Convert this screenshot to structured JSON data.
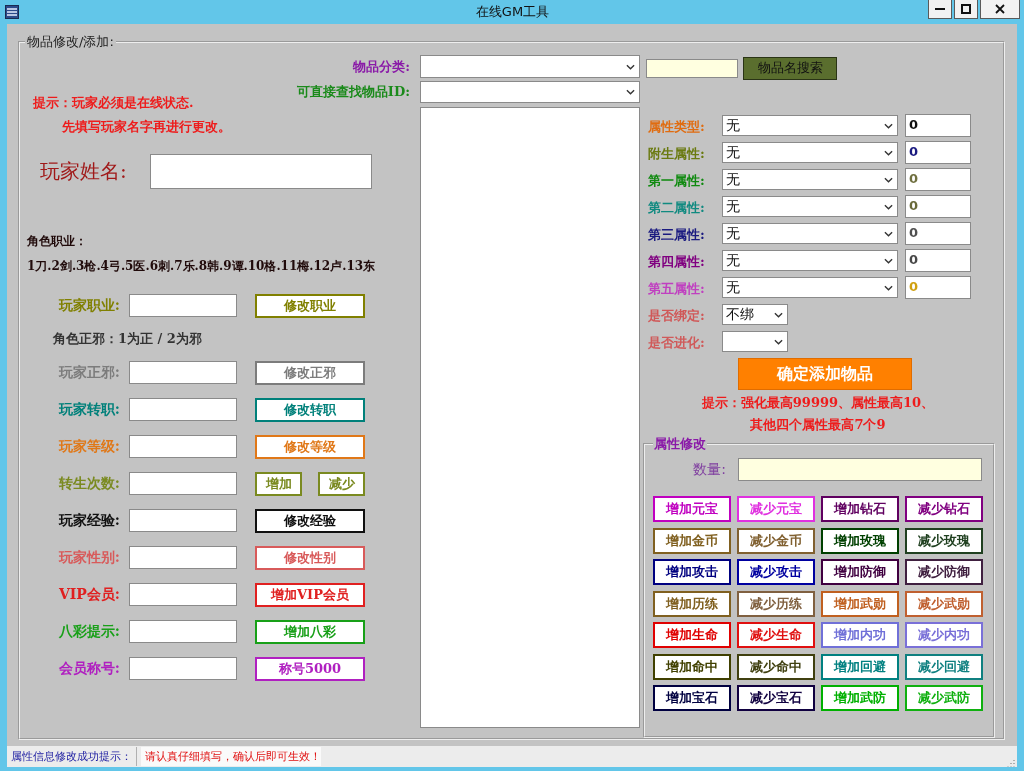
{
  "window": {
    "title": "在线GM工具"
  },
  "group": {
    "title": "物品修改/添加:"
  },
  "item_search": {
    "category_label": "物品分类:",
    "id_label": "可直接查找物品ID:",
    "search_button": "物品名搜索"
  },
  "notice": [
    "提示：玩家必须是在线状态.",
    "先填写玩家名字再进行更改。"
  ],
  "player_name": {
    "label": "玩家姓名:"
  },
  "jobs": {
    "title": "角色职业：",
    "legend": "1刀.2剑.3枪.4弓.5医.6刺.7乐.8韩.9谭.10格.11梅.12卢.13东"
  },
  "player_rows": [
    {
      "kind": "field",
      "label": "玩家职业:",
      "color": "#808000",
      "buttons": [
        "修改职业"
      ]
    },
    {
      "kind": "note",
      "text": "角色正邪：1为正 / 2为邪"
    },
    {
      "kind": "field",
      "label": "玩家正邪:",
      "color": "#7c7c7c",
      "buttons": [
        "修改正邪"
      ]
    },
    {
      "kind": "field",
      "label": "玩家转职:",
      "color": "#00807a",
      "buttons": [
        "修改转职"
      ]
    },
    {
      "kind": "field",
      "label": "玩家等级:",
      "color": "#e07818",
      "buttons": [
        "修改等级"
      ]
    },
    {
      "kind": "field",
      "label": "转生次数:",
      "color": "#7a8a20",
      "buttons": [
        "增加",
        "减少"
      ]
    },
    {
      "kind": "field",
      "label": "玩家经验:",
      "color": "#101010",
      "buttons": [
        "修改经验"
      ]
    },
    {
      "kind": "field",
      "label": "玩家性别:",
      "color": "#d85a5a",
      "buttons": [
        "修改性别"
      ]
    },
    {
      "kind": "field",
      "label": "VIP会员:",
      "color": "#e02020",
      "buttons": [
        "增加VIP会员"
      ]
    },
    {
      "kind": "field",
      "label": "八彩提示:",
      "color": "#18a018",
      "buttons": [
        "增加八彩"
      ]
    },
    {
      "kind": "field",
      "label": "会员称号:",
      "color": "#b020c0",
      "buttons": [
        "称号5000"
      ]
    }
  ],
  "attributes": [
    {
      "label": "属性类型:",
      "color": "#e06c10",
      "value": "无",
      "amount": {
        "text": "0",
        "color": "#101010"
      }
    },
    {
      "label": "附生属性:",
      "color": "#6a7a10",
      "value": "无",
      "amount": {
        "text": "0",
        "color": "#1a1a80"
      }
    },
    {
      "label": "第一属性:",
      "color": "#108a10",
      "value": "无",
      "amount": {
        "text": "0",
        "color": "#707040"
      }
    },
    {
      "label": "第二属性:",
      "color": "#108a80",
      "value": "无",
      "amount": {
        "text": "0",
        "color": "#6a6a3a"
      }
    },
    {
      "label": "第三属性:",
      "color": "#1a1a80",
      "value": "无",
      "amount": {
        "text": "0",
        "color": "#505050"
      }
    },
    {
      "label": "第四属性:",
      "color": "#800080",
      "value": "无",
      "amount": {
        "text": "0",
        "color": "#484848"
      }
    },
    {
      "label": "第五属性:",
      "color": "#c040c0",
      "value": "无",
      "amount": {
        "text": "0",
        "color": "#d0a010"
      }
    }
  ],
  "options": [
    {
      "label": "是否绑定:",
      "color": "#d05858",
      "value": "不绑"
    },
    {
      "label": "是否进化:",
      "color": "#d05a5a"
    }
  ],
  "confirm_button": "确定添加物品",
  "limits_hint": [
    "提示：强化最高99999、属性最高10、",
    "其他四个属性最高7个9"
  ],
  "attr_modify": {
    "title": "属性修改",
    "quantity_label": "数量:",
    "buttons": [
      {
        "label": "增加元宝",
        "color": "#c000c0"
      },
      {
        "label": "减少元宝",
        "color": "#e030e0"
      },
      {
        "label": "增加钻石",
        "color": "#600060"
      },
      {
        "label": "减少钻石",
        "color": "#800080"
      },
      {
        "label": "增加金币",
        "color": "#806020"
      },
      {
        "label": "减少金币",
        "color": "#806030"
      },
      {
        "label": "增加玫瑰",
        "color": "#004000"
      },
      {
        "label": "减少玫瑰",
        "color": "#204020"
      },
      {
        "label": "增加攻击",
        "color": "#000080"
      },
      {
        "label": "减少攻击",
        "color": "#0000a0"
      },
      {
        "label": "增加防御",
        "color": "#400040"
      },
      {
        "label": "减少防御",
        "color": "#402040"
      },
      {
        "label": "增加历练",
        "color": "#806020"
      },
      {
        "label": "减少历练",
        "color": "#806040"
      },
      {
        "label": "增加武勋",
        "color": "#c06020"
      },
      {
        "label": "减少武勋",
        "color": "#c06030"
      },
      {
        "label": "增加生命",
        "color": "#e00000"
      },
      {
        "label": "减少生命",
        "color": "#e01010"
      },
      {
        "label": "增加内功",
        "color": "#7070d8"
      },
      {
        "label": "减少内功",
        "color": "#7a70d8"
      },
      {
        "label": "增加命中",
        "color": "#404000"
      },
      {
        "label": "减少命中",
        "color": "#404010"
      },
      {
        "label": "增加回避",
        "color": "#008080"
      },
      {
        "label": "减少回避",
        "color": "#108080"
      },
      {
        "label": "增加宝石",
        "color": "#000040"
      },
      {
        "label": "减少宝石",
        "color": "#100040"
      },
      {
        "label": "增加武防",
        "color": "#00b000"
      },
      {
        "label": "减少武防",
        "color": "#10b010"
      }
    ]
  },
  "status_bar": {
    "label": "属性信息修改成功提示：",
    "message": "请认真仔细填写，确认后即可生效！"
  }
}
